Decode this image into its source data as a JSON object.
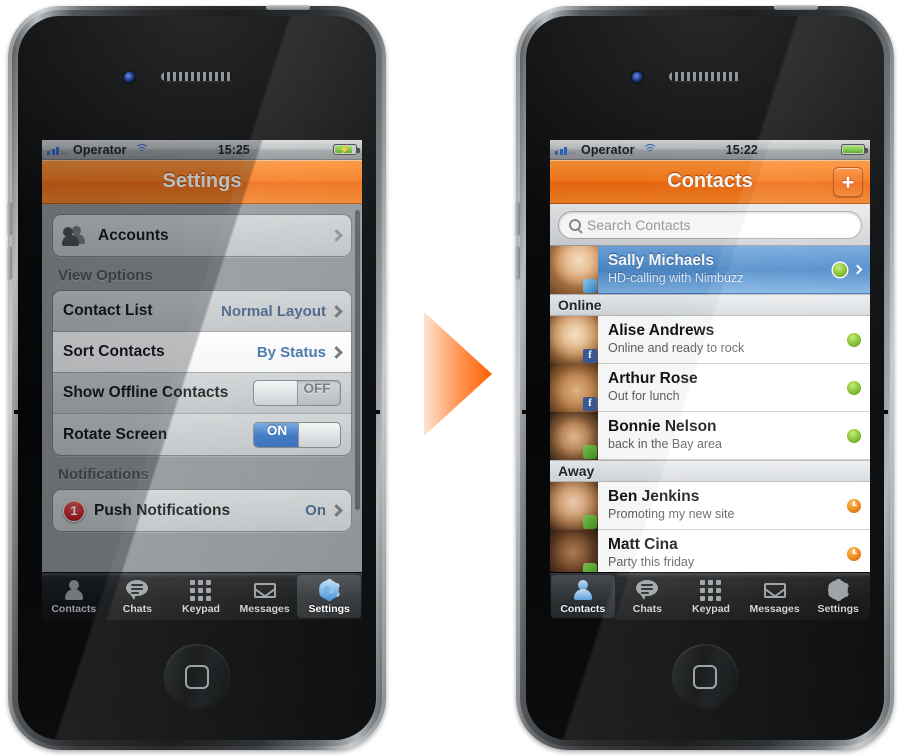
{
  "arrow": {
    "name": "transition-arrow",
    "color_from": "#fde0cb",
    "color_to": "#ff6a00"
  },
  "left_phone": {
    "statusbar": {
      "carrier": "Operator",
      "time": "15:25",
      "battery_state": "charging",
      "signal_icon": "signal-bars-icon",
      "wifi_icon": "wifi-icon",
      "battery_icon": "battery-charging-icon"
    },
    "navbar": {
      "title": "Settings"
    },
    "groups": [
      {
        "section_title": "",
        "rows": [
          {
            "label": "Accounts",
            "value": "",
            "type": "disclosure",
            "icon": "accounts-icon"
          }
        ]
      },
      {
        "section_title": "View Options",
        "rows": [
          {
            "label": "Contact List",
            "value": "Normal Layout",
            "type": "disclosure",
            "icon": ""
          },
          {
            "label": "Sort Contacts",
            "value": "By Status",
            "type": "disclosure",
            "icon": "",
            "highlighted": true
          },
          {
            "label": "Show Offline Contacts",
            "value": "OFF",
            "type": "toggle-off",
            "icon": ""
          },
          {
            "label": "Rotate Screen",
            "value": "ON",
            "type": "toggle-on",
            "icon": ""
          }
        ]
      },
      {
        "section_title": "Notifications",
        "rows": [
          {
            "label": "Push Notifications",
            "value": "On",
            "type": "disclosure",
            "icon": "badge-icon",
            "badge": "1"
          }
        ]
      }
    ],
    "tabs": [
      {
        "label": "Contacts",
        "icon": "person-icon",
        "active": false
      },
      {
        "label": "Chats",
        "icon": "chat-bubble-icon",
        "active": false
      },
      {
        "label": "Keypad",
        "icon": "keypad-grid-icon",
        "active": false
      },
      {
        "label": "Messages",
        "icon": "envelope-icon",
        "active": false
      },
      {
        "label": "Settings",
        "icon": "gear-icon",
        "active": true
      }
    ]
  },
  "right_phone": {
    "statusbar": {
      "carrier": "Operator",
      "time": "15:22",
      "battery_state": "full",
      "signal_icon": "signal-bars-icon",
      "wifi_icon": "wifi-icon",
      "battery_icon": "battery-full-icon"
    },
    "navbar": {
      "title": "Contacts",
      "add_button": "+"
    },
    "search": {
      "placeholder": "Search Contacts",
      "value": "",
      "icon": "search-icon"
    },
    "selected_contact": {
      "name": "Sally Michaels",
      "status": "HD-calling with Nimbuzz",
      "presence": "online",
      "avatar": "av-sally",
      "network": "nim"
    },
    "sections": [
      {
        "title": "Online",
        "contacts": [
          {
            "name": "Alise Andrews",
            "status": "Online and ready to rock",
            "presence": "online",
            "avatar": "av-alise",
            "network": "fb",
            "network_glyph": "f"
          },
          {
            "name": "Arthur Rose",
            "status": "Out for lunch",
            "presence": "online",
            "avatar": "av-arthur",
            "network": "fb",
            "network_glyph": "f"
          },
          {
            "name": "Bonnie Nelson",
            "status": "back in the Bay area",
            "presence": "online",
            "avatar": "av-bonnie",
            "network": "msn",
            "network_glyph": ""
          }
        ]
      },
      {
        "title": "Away",
        "contacts": [
          {
            "name": "Ben Jenkins",
            "status": "Promoting my new site",
            "presence": "away",
            "avatar": "av-ben",
            "network": "msn",
            "network_glyph": ""
          },
          {
            "name": "Matt Cina",
            "status": "Party this friday",
            "presence": "away",
            "avatar": "av-matt",
            "network": "msn",
            "network_glyph": ""
          }
        ]
      }
    ],
    "tabs": [
      {
        "label": "Contacts",
        "icon": "person-icon",
        "active": true
      },
      {
        "label": "Chats",
        "icon": "chat-bubble-icon",
        "active": false
      },
      {
        "label": "Keypad",
        "icon": "keypad-grid-icon",
        "active": false
      },
      {
        "label": "Messages",
        "icon": "envelope-icon",
        "active": false
      },
      {
        "label": "Settings",
        "icon": "gear-icon",
        "active": false
      }
    ]
  }
}
